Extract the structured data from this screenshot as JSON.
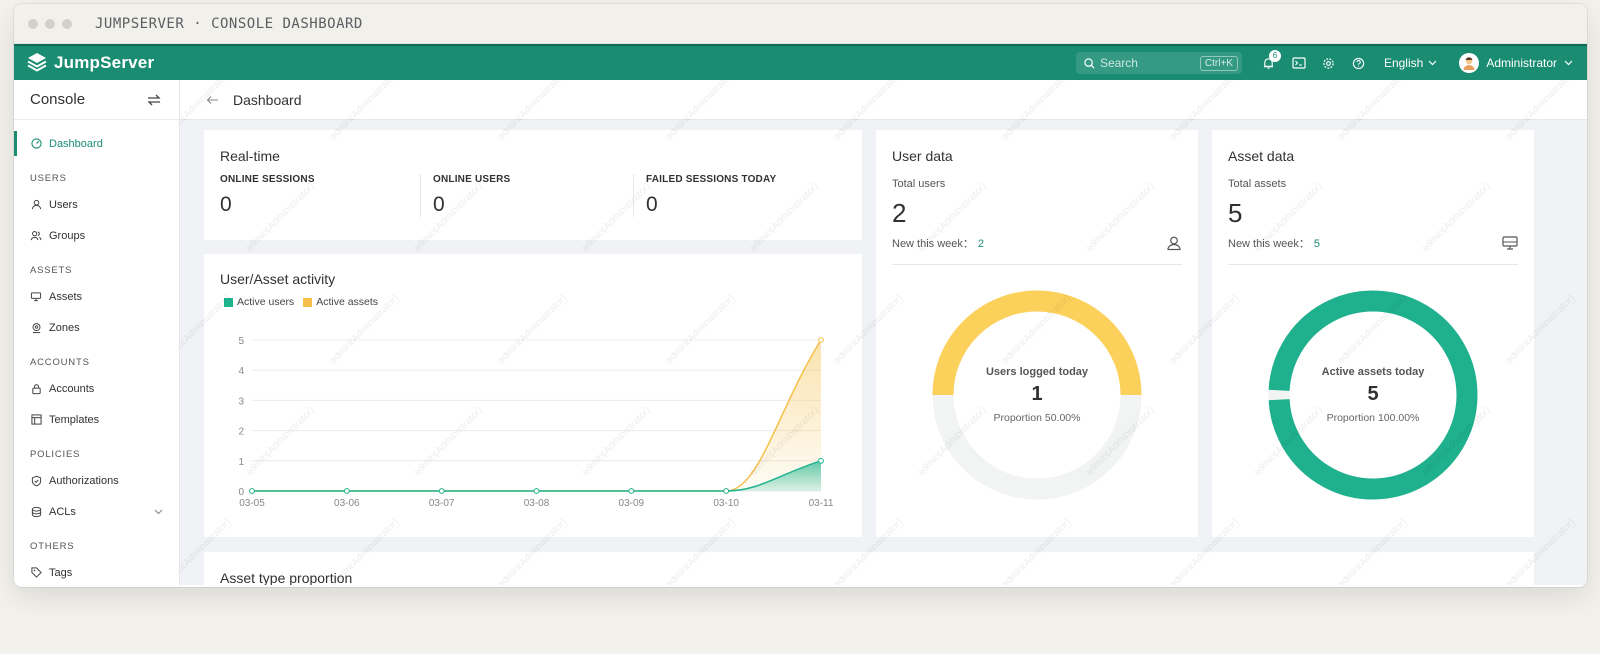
{
  "window": {
    "title": "JUMPSERVER · CONSOLE DASHBOARD"
  },
  "topbar": {
    "brand": "JumpServer",
    "search_placeholder": "Search",
    "search_shortcut": "Ctrl+K",
    "notification_count": "6",
    "language": "English",
    "user_name": "Administrator"
  },
  "sidebar": {
    "title": "Console",
    "dashboard": "Dashboard",
    "groups": {
      "users": "USERS",
      "assets": "ASSETS",
      "accounts": "ACCOUNTS",
      "policies": "POLICIES",
      "others": "OTHERS"
    },
    "items": {
      "users": "Users",
      "groups": "Groups",
      "assets": "Assets",
      "zones": "Zones",
      "accounts": "Accounts",
      "templates": "Templates",
      "authorizations": "Authorizations",
      "acls": "ACLs",
      "tags": "Tags"
    }
  },
  "breadcrumb": {
    "title": "Dashboard"
  },
  "realtime": {
    "title": "Real-time",
    "online_sessions_label": "ONLINE SESSIONS",
    "online_sessions": "0",
    "online_users_label": "ONLINE USERS",
    "online_users": "0",
    "failed_sessions_label": "FAILED SESSIONS TODAY",
    "failed_sessions": "0"
  },
  "activity": {
    "title": "User/Asset activity",
    "legend_users": "Active users",
    "legend_assets": "Active assets"
  },
  "user_data": {
    "title": "User data",
    "total_label": "Total users",
    "total": "2",
    "new_label": "New this week：",
    "new_value": "2",
    "donut_label": "Users logged today",
    "donut_value": "1",
    "donut_proportion": "Proportion 50.00%",
    "fraction": 0.5
  },
  "asset_data": {
    "title": "Asset data",
    "total_label": "Total assets",
    "total": "5",
    "new_label": "New this week：",
    "new_value": "5",
    "donut_label": "Active assets today",
    "donut_value": "5",
    "donut_proportion": "Proportion 100.00%",
    "fraction": 1.0
  },
  "asset_type": {
    "title": "Asset type proportion"
  },
  "watermark": "admin(Administrator)",
  "colors": {
    "brand": "#1a8c72",
    "users_series": "#1fb58f",
    "assets_series": "#f5c04a",
    "donut_users": "#fcd15b",
    "donut_assets": "#1fb08d",
    "donut_track": "#f2f4f3"
  },
  "chart_data": {
    "type": "area",
    "categories": [
      "03-05",
      "03-06",
      "03-07",
      "03-08",
      "03-09",
      "03-10",
      "03-11"
    ],
    "series": [
      {
        "name": "Active users",
        "values": [
          0,
          0,
          0,
          0,
          0,
          0,
          1
        ]
      },
      {
        "name": "Active assets",
        "values": [
          0,
          0,
          0,
          0,
          0,
          0,
          5
        ]
      }
    ],
    "ylim": [
      0,
      5
    ],
    "yticks": [
      "0",
      "1",
      "2",
      "3",
      "4",
      "5"
    ],
    "grid": true,
    "legend_position": "top-left"
  }
}
